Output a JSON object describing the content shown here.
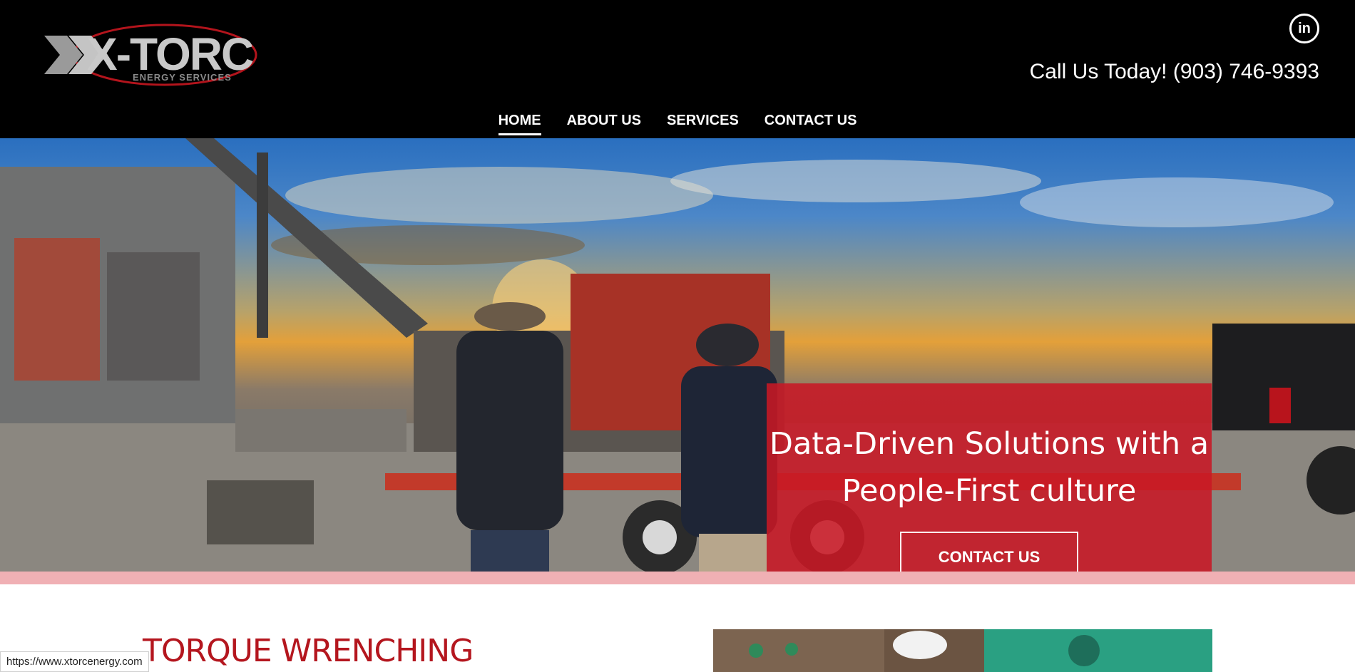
{
  "header": {
    "logo_text": "X-TORC",
    "logo_subtitle": "ENERGY SERVICES",
    "social_icon": "linkedin-icon",
    "social_label": "in",
    "phone_text": "Call Us Today! (903) 746-9393"
  },
  "nav": {
    "items": [
      {
        "label": "HOME",
        "active": true
      },
      {
        "label": "ABOUT US",
        "active": false
      },
      {
        "label": "SERVICES",
        "active": false
      },
      {
        "label": "CONTACT US",
        "active": false
      }
    ]
  },
  "hero": {
    "title_line1": "Data-Driven Solutions with a",
    "title_line2": "People-First culture",
    "button_label": "CONTACT US"
  },
  "section": {
    "title": "TORQUE WRENCHING"
  },
  "status_bar": {
    "url": "https://www.xtorcenergy.com"
  },
  "colors": {
    "header_bg": "#000000",
    "accent_red": "#c81824",
    "title_red": "#b4161e",
    "pink_band": "#f0b0b4"
  }
}
